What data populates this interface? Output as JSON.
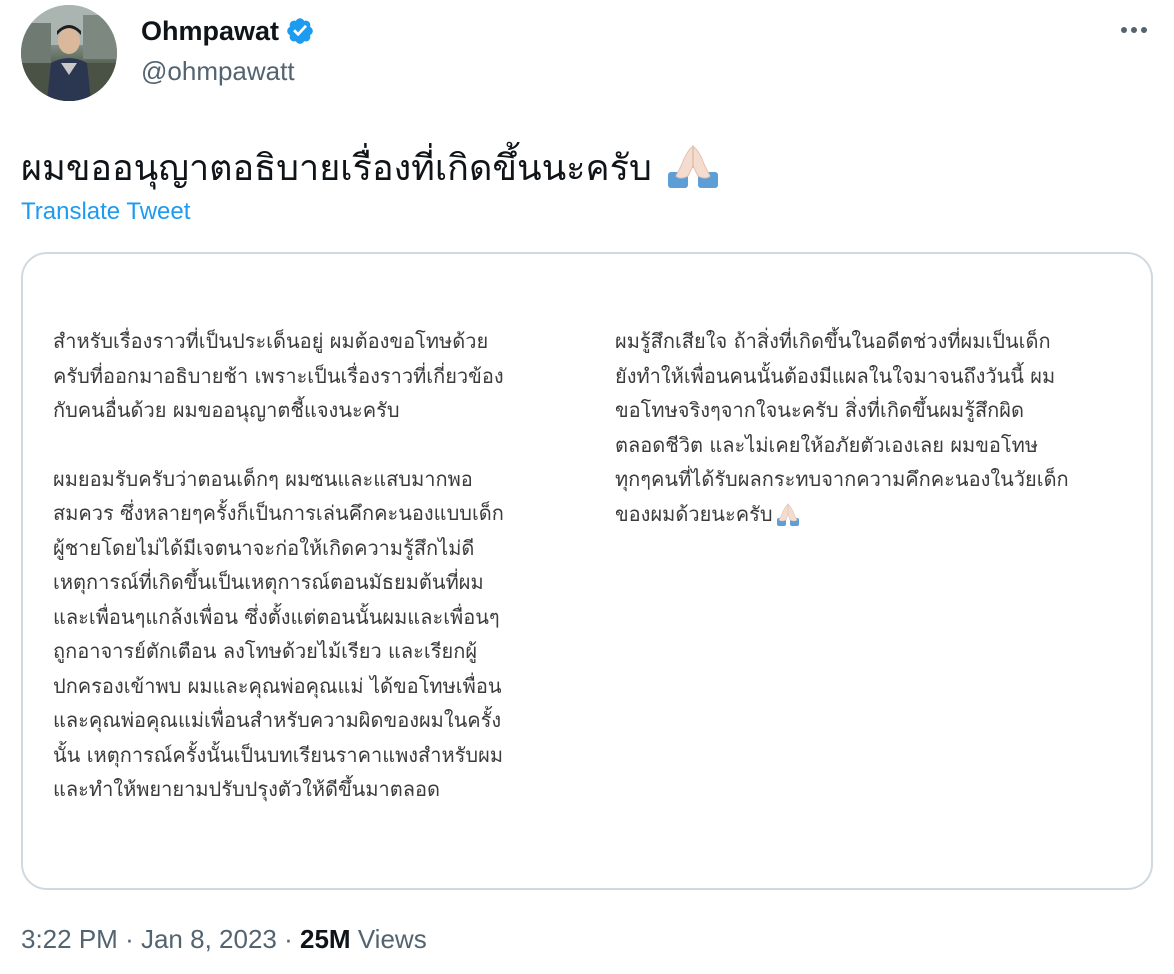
{
  "author": {
    "display_name": "Ohmpawat",
    "handle": "@ohmpawatt",
    "verified": true,
    "verified_color": "#1d9bf0"
  },
  "tweet": {
    "text": "ผมขออนุญาตอธิบายเรื่องที่เกิดขึ้นนะครับ",
    "emoji": "folded-hands",
    "translate_label": "Translate Tweet"
  },
  "image_text": {
    "left_paragraphs": [
      [
        "สำหรับเรื่องราวที่เป็นประเด็นอยู่ ผมต้องขอโทษด้วย",
        "ครับที่ออกมาอธิบายช้า เพราะเป็นเรื่องราวที่เกี่ยวข้อง",
        "กับคนอื่นด้วย ผมขออนุญาตชี้แจงนะครับ"
      ],
      [
        "ผมยอมรับครับว่าตอนเด็กๆ ผมซนและแสบมากพอ",
        "สมควร ซึ่งหลายๆครั้งก็เป็นการเล่นคึกคะนองแบบเด็ก",
        "ผู้ชายโดยไม่ได้มีเจตนาจะก่อให้เกิดความรู้สึกไม่ดี",
        "เหตุการณ์ที่เกิดขึ้นเป็นเหตุการณ์ตอนมัธยมต้นที่ผม",
        "และเพื่อนๆแกล้งเพื่อน ซึ่งตั้งแต่ตอนนั้นผมและเพื่อนๆ",
        "ถูกอาจารย์ตักเตือน ลงโทษด้วยไม้เรียว และเรียกผู้",
        "ปกครองเข้าพบ ผมและคุณพ่อคุณแม่ ได้ขอโทษเพื่อน",
        "และคุณพ่อคุณแม่เพื่อนสำหรับความผิดของผมในครั้ง",
        "นั้น เหตุการณ์ครั้งนั้นเป็นบทเรียนราคาแพงสำหรับผม",
        "และทำให้พยายามปรับปรุงตัวให้ดีขึ้นมาตลอด"
      ]
    ],
    "right_lines": [
      "ผมรู้สึกเสียใจ ถ้าสิ่งที่เกิดขึ้นในอดีตช่วงที่ผมเป็นเด็ก",
      "ยังทำให้เพื่อนคนนั้นต้องมีแผลในใจมาจนถึงวันนี้ ผม",
      "ขอโทษจริงๆจากใจนะครับ สิ่งที่เกิดขึ้นผมรู้สึกผิด",
      "ตลอดชีวิต และไม่เคยให้อภัยตัวเองเลย ผมขอโทษ",
      "ทุกๆคนที่ได้รับผลกระทบจากความคึกคะนองในวัยเด็ก",
      "ของผมด้วยนะครับ"
    ]
  },
  "meta": {
    "time": "3:22 PM",
    "separator": "·",
    "date": "Jan 8, 2023",
    "views_count": "25M",
    "views_label": "Views"
  }
}
